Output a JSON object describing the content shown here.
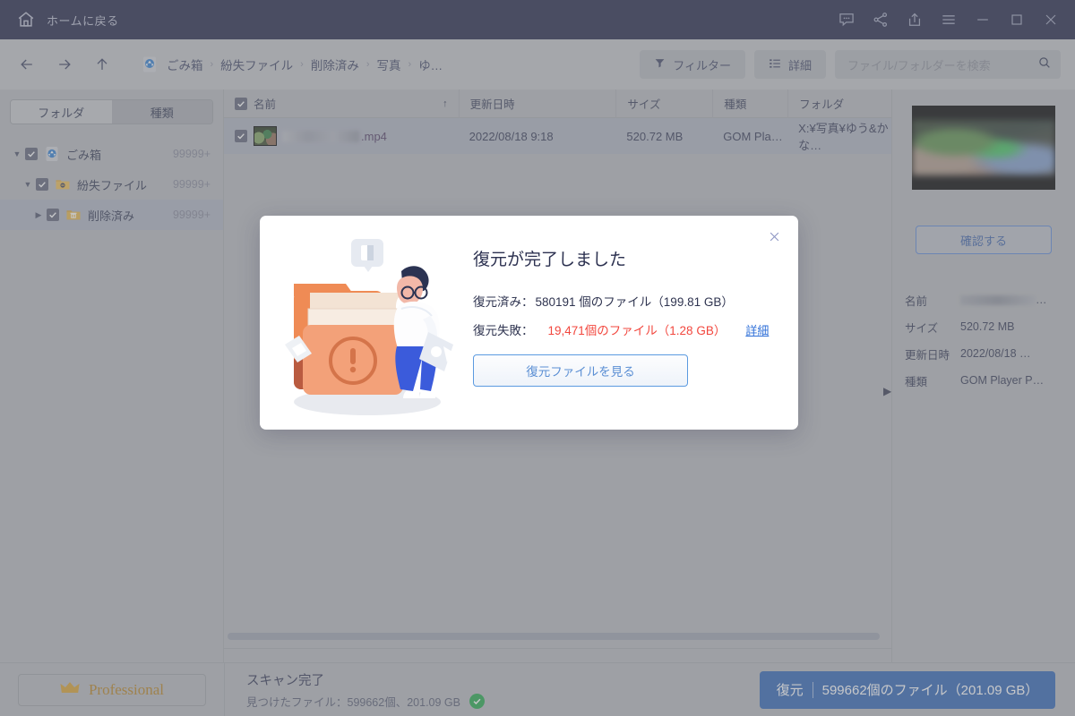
{
  "titlebar": {
    "home_label": "ホームに戻る",
    "home_icon": "home-icon",
    "buttons": [
      {
        "name": "feedback-icon",
        "label": "フィードバック"
      },
      {
        "name": "share-icon",
        "label": "共有"
      },
      {
        "name": "export-icon",
        "label": "エクスポート"
      },
      {
        "name": "menu-icon",
        "label": "メニュー"
      },
      {
        "name": "minimize-icon",
        "label": "最小化"
      },
      {
        "name": "maximize-icon",
        "label": "最大化"
      },
      {
        "name": "close-icon",
        "label": "閉じる"
      }
    ]
  },
  "toolbar": {
    "breadcrumb": [
      "ごみ箱",
      "紛失ファイル",
      "削除済み",
      "写真",
      "ゆ…"
    ],
    "separator": "›",
    "filter_label": "フィルター",
    "details_label": "詳細",
    "search_placeholder": "ファイル/フォルダーを検索",
    "search_value": ""
  },
  "sidebar": {
    "tabs": [
      {
        "label": "フォルダ",
        "active": true
      },
      {
        "label": "種類",
        "active": false
      }
    ],
    "tree": [
      {
        "label": "ごみ箱",
        "count": "99999+",
        "level": 1,
        "expanded": true,
        "checked": true,
        "icon": "recycle-bin-icon",
        "selected": false
      },
      {
        "label": "紛失ファイル",
        "count": "99999+",
        "level": 2,
        "expanded": true,
        "checked": true,
        "icon": "folder-minus-icon",
        "selected": false
      },
      {
        "label": "削除済み",
        "count": "99999+",
        "level": 3,
        "expanded": false,
        "checked": true,
        "icon": "folder-trash-icon",
        "selected": true
      }
    ]
  },
  "filelist": {
    "columns": [
      "名前",
      "更新日時",
      "サイズ",
      "種類",
      "フォルダ"
    ],
    "sort_indicator": "↑",
    "rows": [
      {
        "name_suffix": ".mp4",
        "name_blurred": true,
        "date": "2022/08/18 9:18",
        "size": "520.72 MB",
        "type": "GOM Pla…",
        "folder": "X:¥写真¥ゆう&かな…",
        "checked": true,
        "selected": true
      }
    ]
  },
  "preview": {
    "confirm_label": "確認する",
    "collapse_icon": "chevron-right-icon",
    "meta": [
      {
        "key": "名前",
        "value": "",
        "blurred": true,
        "tail": "…"
      },
      {
        "key": "サイズ",
        "value": "520.72 MB",
        "blurred": false
      },
      {
        "key": "更新日時",
        "value": "2022/08/18 …",
        "blurred": false
      },
      {
        "key": "種類",
        "value": "GOM Player P…",
        "blurred": false
      }
    ]
  },
  "footer": {
    "pro_label": "Professional",
    "pro_icon": "crown-icon",
    "scan_title": "スキャン完了",
    "scan_sub": "見つけたファイル：599662個、201.09 GB",
    "status_icon": "check-circle-icon",
    "restore_label": "復元",
    "restore_detail": "599662個のファイル（201.09 GB）"
  },
  "modal": {
    "title": "復元が完了しました",
    "close_icon": "close-icon",
    "illustration": "folder-warning-person-illustration",
    "success_key": "復元済み：",
    "success_value": "580191 個のファイル（199.81 GB）",
    "fail_key": "復元失敗：",
    "fail_value": "19,471個のファイル（1.28 GB）",
    "detail_link": "詳細",
    "view_button": "復元ファイルを見る",
    "fail_color": "#f2473e",
    "link_color": "#2e6fd8",
    "accent_color": "#2c63b5"
  }
}
